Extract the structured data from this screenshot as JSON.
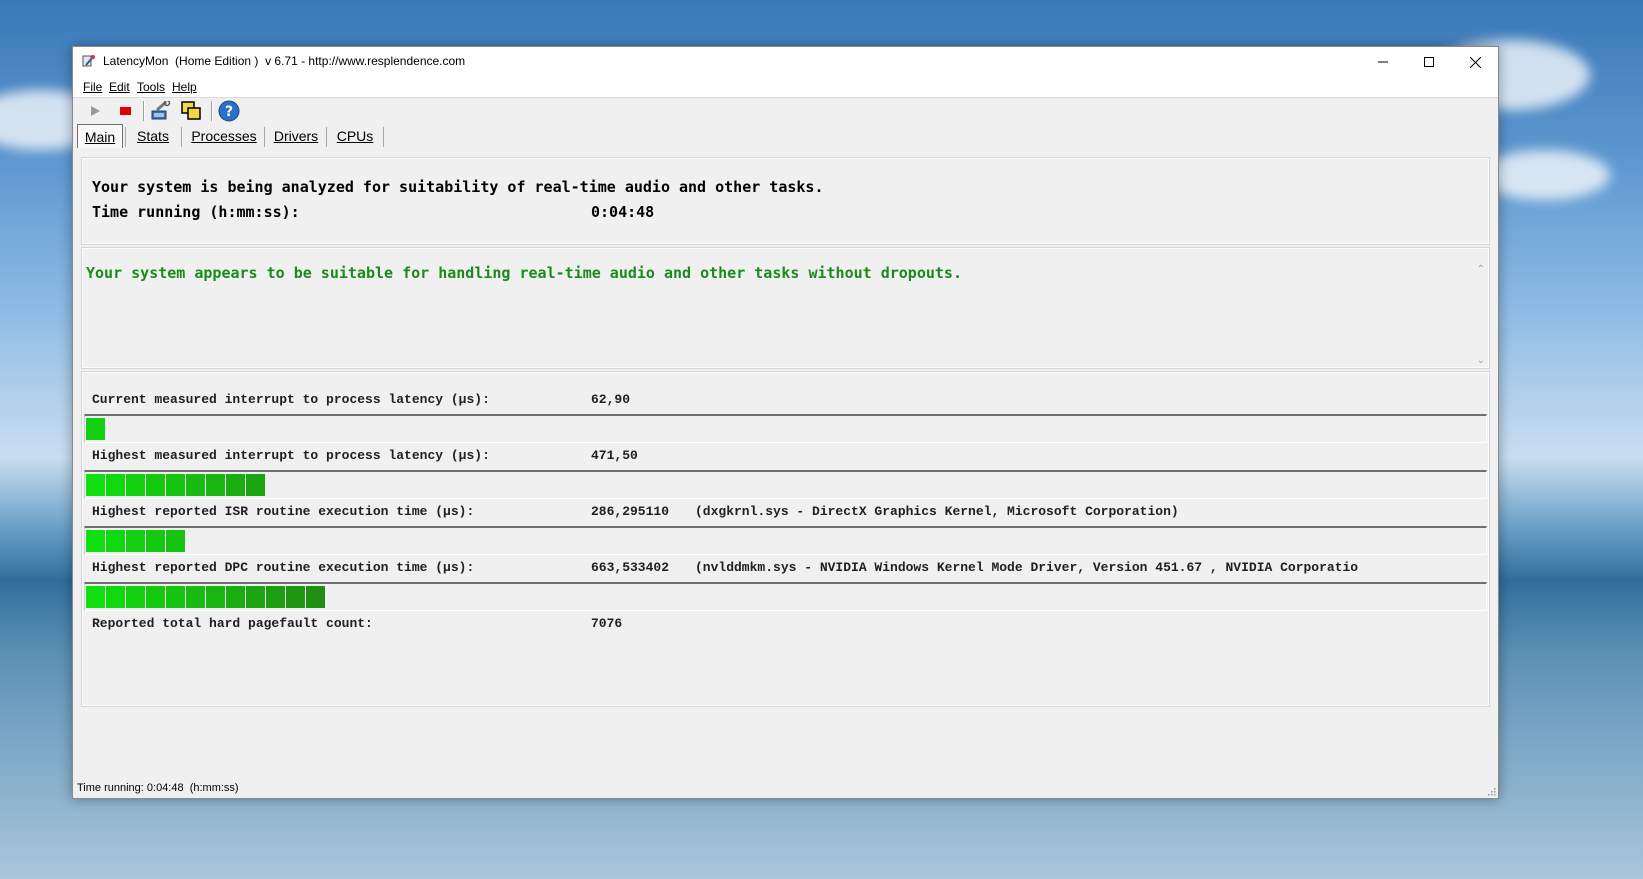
{
  "window": {
    "title": "LatencyMon  (Home Edition )  v 6.71 - http://www.resplendence.com"
  },
  "menu": [
    "File",
    "Edit",
    "Tools",
    "Help"
  ],
  "tabs": [
    "Main",
    "Stats",
    "Processes",
    "Drivers",
    "CPUs"
  ],
  "active_tab": "Main",
  "header": {
    "analyzing_text": "Your system is being analyzed for suitability of real-time audio and other tasks.",
    "time_label": "Time running (h:mm:ss):",
    "time_value": "0:04:48"
  },
  "conclusion": {
    "text": "Your system appears to be suitable for handling real-time audio and other tasks without dropouts.",
    "color": "#1a8a1a"
  },
  "metrics": [
    {
      "label": "Current measured interrupt to process latency (µs):",
      "value": "62,90",
      "extra": "",
      "segments": 1,
      "level": 0.014
    },
    {
      "label": "Highest measured interrupt to process latency (µs):",
      "value": "471,50",
      "extra": "",
      "segments": 9,
      "level": 0.13
    },
    {
      "label": "Highest reported ISR routine execution time (µs):",
      "value": "286,295110",
      "extra": "(dxgkrnl.sys - DirectX Graphics Kernel, Microsoft Corporation)",
      "segments": 5,
      "level": 0.08
    },
    {
      "label": "Highest reported DPC routine execution time (µs):",
      "value": "663,533402",
      "extra": "(nvlddmkm.sys - NVIDIA Windows Kernel Mode Driver, Version 451.67 , NVIDIA Corporatio",
      "segments": 12,
      "level": 0.19
    },
    {
      "label": "Reported total hard pagefault count:",
      "value": "7076",
      "extra": ""
    }
  ],
  "status": {
    "text": "Time running: 0:04:48  (h:mm:ss)"
  },
  "colors": {
    "bar_bright": "#10e010",
    "bar_dark": "#1f8f12"
  }
}
